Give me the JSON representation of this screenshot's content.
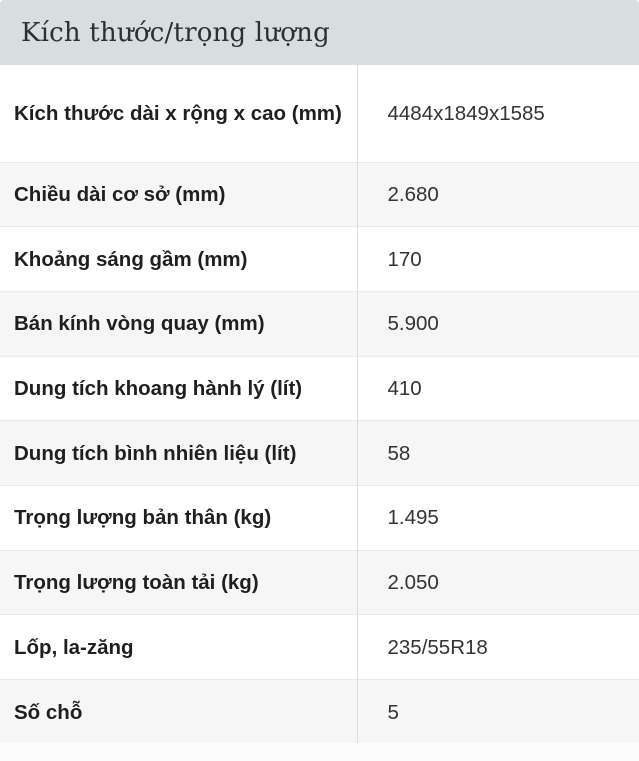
{
  "header": {
    "title": "Kích thước/trọng lượng"
  },
  "specs": [
    {
      "label": "Kích thước dài x rộng x cao (mm)",
      "value": "4484x1849x1585"
    },
    {
      "label": "Chiều dài cơ sở (mm)",
      "value": "2.680"
    },
    {
      "label": "Khoảng sáng gầm (mm)",
      "value": "170"
    },
    {
      "label": "Bán kính vòng quay (mm)",
      "value": "5.900"
    },
    {
      "label": "Dung tích khoang hành lý (lít)",
      "value": "410"
    },
    {
      "label": "Dung tích bình nhiên liệu (lít)",
      "value": "58"
    },
    {
      "label": "Trọng lượng bản thân (kg)",
      "value": "1.495"
    },
    {
      "label": "Trọng lượng toàn tải (kg)",
      "value": "2.050"
    },
    {
      "label": "Lốp, la-zăng",
      "value": "235/55R18"
    },
    {
      "label": "Số chỗ",
      "value": "5"
    }
  ],
  "colors": {
    "header_background": "#d6dee0",
    "row_alt_background": "#f6f6f6",
    "border": "#dcdcdc"
  }
}
